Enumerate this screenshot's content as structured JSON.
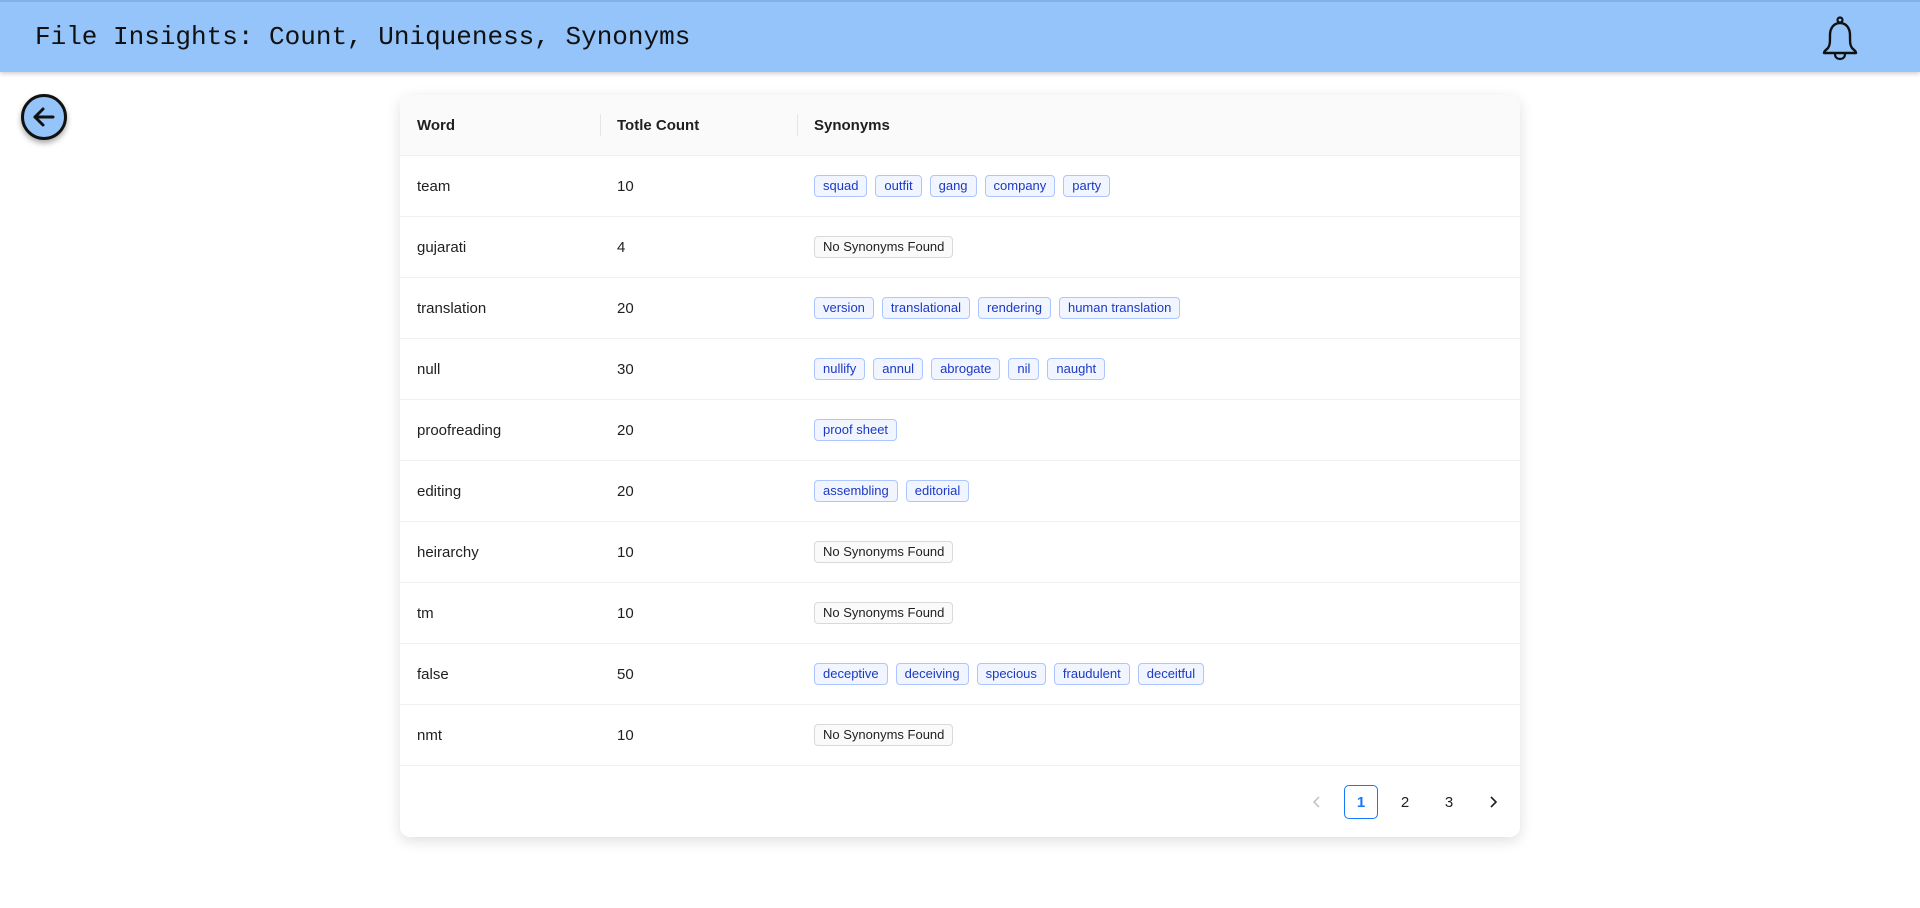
{
  "header": {
    "title": "File Insights: Count, Uniqueness, Synonyms"
  },
  "icons": {
    "notifications": "bell-icon",
    "back": "arrow-left-circle-icon"
  },
  "colors": {
    "header_bg": "#94c4f9",
    "tag_text": "#1d39c4",
    "tag_bg": "#f0f5ff",
    "active_page": "#1677ff"
  },
  "table": {
    "columns": [
      "Word",
      "Totle Count",
      "Synonyms"
    ],
    "rows": [
      {
        "word": "team",
        "count": "10",
        "synonyms": [
          "squad",
          "outfit",
          "gang",
          "company",
          "party"
        ]
      },
      {
        "word": "gujarati",
        "count": "4",
        "synonyms": []
      },
      {
        "word": "translation",
        "count": "20",
        "synonyms": [
          "version",
          "translational",
          "rendering",
          "human translation"
        ]
      },
      {
        "word": "null",
        "count": "30",
        "synonyms": [
          "nullify",
          "annul",
          "abrogate",
          "nil",
          "naught"
        ]
      },
      {
        "word": "proofreading",
        "count": "20",
        "synonyms": [
          "proof sheet"
        ]
      },
      {
        "word": "editing",
        "count": "20",
        "synonyms": [
          "assembling",
          "editorial"
        ]
      },
      {
        "word": "heirarchy",
        "count": "10",
        "synonyms": []
      },
      {
        "word": "tm",
        "count": "10",
        "synonyms": []
      },
      {
        "word": "false",
        "count": "50",
        "synonyms": [
          "deceptive",
          "deceiving",
          "specious",
          "fraudulent",
          "deceitful"
        ]
      },
      {
        "word": "nmt",
        "count": "10",
        "synonyms": []
      }
    ],
    "no_synonyms_label": "No Synonyms Found"
  },
  "pagination": {
    "prev": "<",
    "next": ">",
    "pages": [
      "1",
      "2",
      "3"
    ],
    "current": "1"
  }
}
